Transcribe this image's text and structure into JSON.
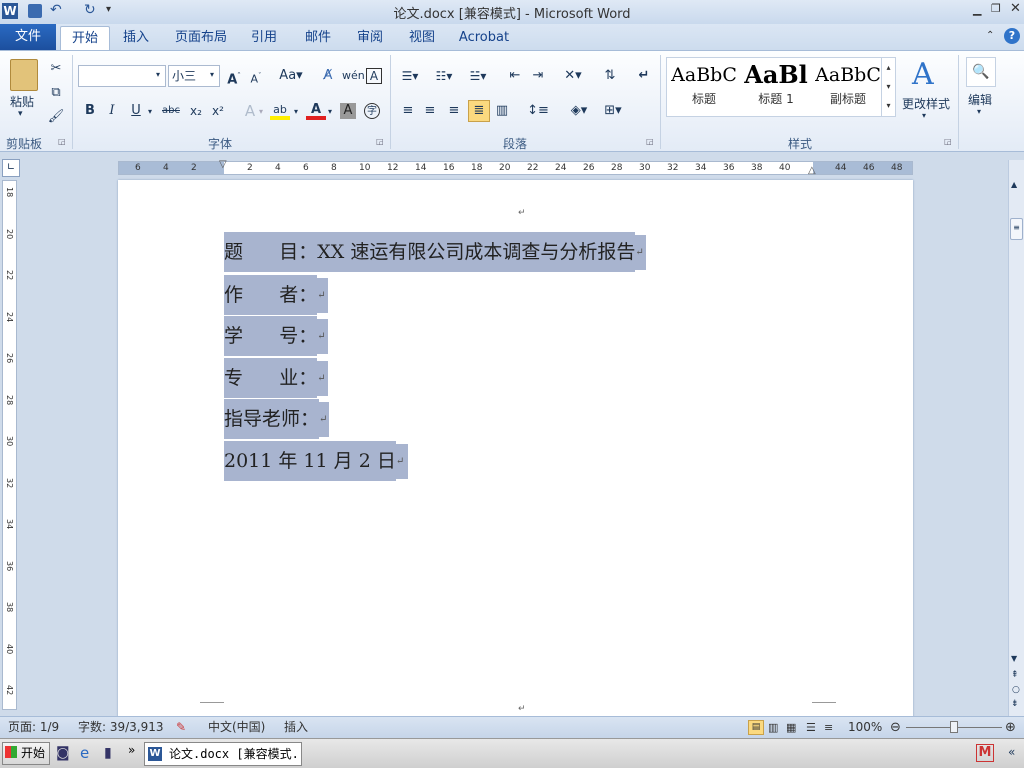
{
  "window": {
    "title": "论文.docx [兼容模式] - Microsoft Word",
    "app_icon": "W"
  },
  "quick_access": {
    "icons": [
      "save-icon",
      "undo-icon",
      "redo-icon",
      "customize-icon"
    ]
  },
  "tabs": {
    "file": "文件",
    "items": [
      "开始",
      "插入",
      "页面布局",
      "引用",
      "邮件",
      "审阅",
      "视图",
      "Acrobat"
    ],
    "active": "开始"
  },
  "ribbon": {
    "clipboard": {
      "paste_label": "粘贴",
      "group_label": "剪贴板"
    },
    "font": {
      "font_name": "",
      "font_size": "小三",
      "group_label": "字体"
    },
    "paragraph": {
      "group_label": "段落"
    },
    "styles": {
      "group_label": "样式",
      "items": [
        {
          "sample": "AaBbC",
          "name": "标题"
        },
        {
          "sample": "AaBl",
          "name": "标题 1"
        },
        {
          "sample": "AaBbC",
          "name": "副标题"
        }
      ],
      "change_styles_label": "更改样式"
    },
    "editing": {
      "label": "编辑"
    }
  },
  "ruler": {
    "ticks": [
      "6",
      "4",
      "2",
      "2",
      "4",
      "6",
      "8",
      "10",
      "12",
      "14",
      "16",
      "18",
      "20",
      "22",
      "24",
      "26",
      "28",
      "30",
      "32",
      "34",
      "36",
      "38",
      "40",
      "44",
      "46",
      "48"
    ],
    "vticks": [
      "18",
      "20",
      "22",
      "24",
      "26",
      "28",
      "30",
      "32",
      "34",
      "36",
      "38",
      "40",
      "42"
    ]
  },
  "document": {
    "lines": [
      {
        "label": "题      目：",
        "value": "XX 速运有限公司成本调查与分析报告"
      },
      {
        "label": "作      者：",
        "value": ""
      },
      {
        "label": "学      号：",
        "value": ""
      },
      {
        "label": "专      业：",
        "value": ""
      },
      {
        "label": "指导老师：",
        "value": ""
      },
      {
        "label": "2011 年 11 月 2 日",
        "value": ""
      }
    ],
    "paragraph_mark": "↵"
  },
  "status": {
    "page": "页面: 1/9",
    "words": "字数: 39/3,913",
    "language": "中文(中国)",
    "mode": "插入",
    "zoom": "100%"
  },
  "taskbar": {
    "start": "开始",
    "task": "论文.docx [兼容模式..."
  }
}
